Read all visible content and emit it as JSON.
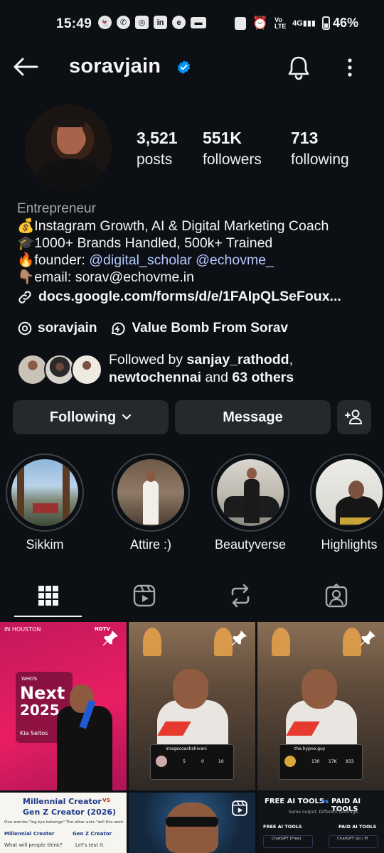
{
  "status": {
    "time": "15:49",
    "battery": "46%",
    "network": "4G",
    "volte": "Vo LTE"
  },
  "header": {
    "username": "soravjain"
  },
  "stats": {
    "posts": {
      "value": "3,521",
      "label": "posts"
    },
    "followers": {
      "value": "551K",
      "label": "followers"
    },
    "following": {
      "value": "713",
      "label": "following"
    }
  },
  "bio": {
    "category": "Entrepreneur",
    "line1_emoji": "💰",
    "line1": "Instagram Growth, AI & Digital Marketing Coach",
    "line2_emoji": "🎓",
    "line2": "1000+ Brands Handled, 500k+ Trained",
    "line3_emoji": "🔥",
    "line3_prefix": "founder: ",
    "mention1": "@digital_scholar",
    "mention2": "@echovme_",
    "line4_emoji": "👇🏽",
    "line4": "email: sorav@echovme.in",
    "link": "docs.google.com/forms/d/e/1FAIpQLSeFoux..."
  },
  "chips": {
    "threads": "soravjain",
    "channel": "Value Bomb From Sorav"
  },
  "followed_by": {
    "prefix": "Followed by ",
    "user1": "sanjay_rathodd",
    "sep": ",",
    "user2": "newtochennai",
    "middle": " and ",
    "others": "63 others"
  },
  "actions": {
    "following": "Following",
    "message": "Message"
  },
  "highlights": [
    {
      "label": "Sikkim"
    },
    {
      "label": "Attire :)"
    },
    {
      "label": "Beautyverse"
    },
    {
      "label": "Highlights"
    }
  ],
  "posts": {
    "p1": {
      "tag": "WHOS",
      "big": "Next",
      "year": "2025",
      "name": "Kia Seltos",
      "logo": "NDTV"
    },
    "p2": {
      "account": "imagecoachshivani",
      "posts": "5",
      "followers": "0",
      "following": "10"
    },
    "p3": {
      "account": "the.hypno.guy",
      "posts": "130",
      "followers": "17K",
      "following": "933"
    },
    "p4": {
      "title_a": "Millennial Creator",
      "vs": "vs",
      "title_b": "Gen Z Creator (2026)",
      "sub": "One worries \"log kya kahenge\" The other asks \"will this work?\"",
      "col_a": "Millennial Creator",
      "col_b": "Gen Z Creator",
      "row_a": "What will people think?",
      "row_b": "Let's test it."
    },
    "p6": {
      "title_a": "FREE AI TOOLS",
      "vs": "vs",
      "title_b": "PAID AI TOOLS",
      "sub": "Same output. Different leverage.",
      "col_a": "FREE AI TOOLS",
      "col_b": "PAID AI TOOLS",
      "item_a": "ChatGPT (Free)",
      "item_b": "ChatGPT Go / Pl"
    }
  },
  "colors": {
    "background": "#0c1014",
    "button": "#25292e",
    "mention": "#b3c7ff",
    "verified": "#0095f6"
  }
}
